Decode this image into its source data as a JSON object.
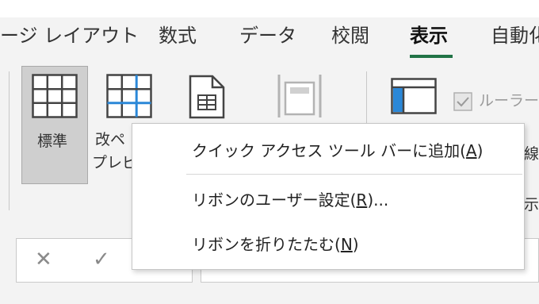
{
  "tabs": [
    {
      "label": "ージ レイアウト"
    },
    {
      "label": "数式"
    },
    {
      "label": "データ"
    },
    {
      "label": "校閲"
    },
    {
      "label": "表示"
    },
    {
      "label": "自動化"
    }
  ],
  "ribbon": {
    "normal_label": "標準",
    "page_break_label_1": "改ペ",
    "page_break_label_2": "プレビ",
    "ruler_label": "ルーラー",
    "partial_right_1": "線",
    "partial_right_2": "示"
  },
  "formula_bar": {
    "cancel_glyph": "✕",
    "enter_glyph": "✓"
  },
  "context_menu": {
    "items": [
      {
        "text": "クイック アクセス ツール バーに追加(",
        "key": "A",
        "suffix": ")"
      },
      {
        "text": "リボンのユーザー設定(",
        "key": "R",
        "suffix": ")..."
      },
      {
        "text": "リボンを折りたたむ(",
        "key": "N",
        "suffix": ")"
      }
    ]
  },
  "colors": {
    "accent": "#217346",
    "icon_blue": "#2b88d8",
    "icon_gray": "#444444"
  }
}
